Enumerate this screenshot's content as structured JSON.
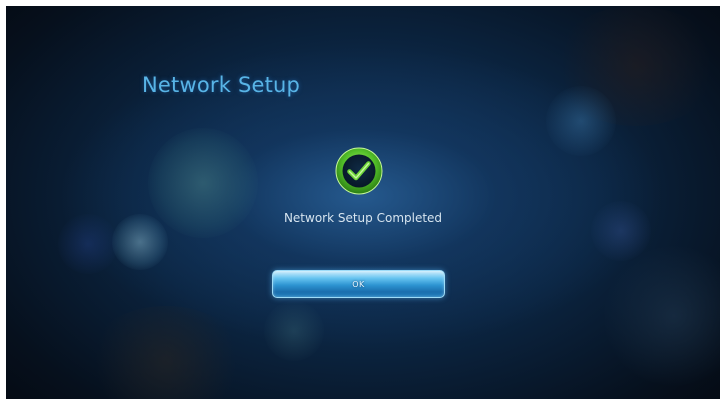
{
  "screen": {
    "title": "Network Setup",
    "message": "Network Setup Completed",
    "ok_label": "OK",
    "icon": "checkmark-circle-icon"
  },
  "colors": {
    "title": "#58b4e6",
    "accent_green": "#56c22b",
    "button_blue": "#2c93d1"
  }
}
